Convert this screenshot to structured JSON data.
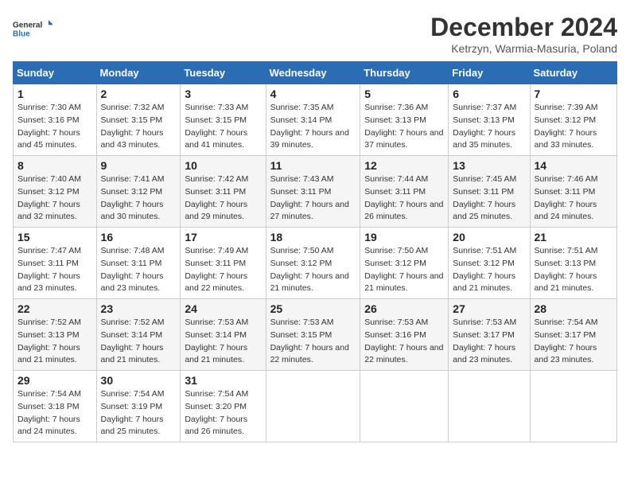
{
  "logo": {
    "general": "General",
    "blue": "Blue"
  },
  "title": "December 2024",
  "subtitle": "Ketrzyn, Warmia-Masuria, Poland",
  "header_days": [
    "Sunday",
    "Monday",
    "Tuesday",
    "Wednesday",
    "Thursday",
    "Friday",
    "Saturday"
  ],
  "weeks": [
    [
      {
        "day": "1",
        "sunrise": "Sunrise: 7:30 AM",
        "sunset": "Sunset: 3:16 PM",
        "daylight": "Daylight: 7 hours and 45 minutes."
      },
      {
        "day": "2",
        "sunrise": "Sunrise: 7:32 AM",
        "sunset": "Sunset: 3:15 PM",
        "daylight": "Daylight: 7 hours and 43 minutes."
      },
      {
        "day": "3",
        "sunrise": "Sunrise: 7:33 AM",
        "sunset": "Sunset: 3:15 PM",
        "daylight": "Daylight: 7 hours and 41 minutes."
      },
      {
        "day": "4",
        "sunrise": "Sunrise: 7:35 AM",
        "sunset": "Sunset: 3:14 PM",
        "daylight": "Daylight: 7 hours and 39 minutes."
      },
      {
        "day": "5",
        "sunrise": "Sunrise: 7:36 AM",
        "sunset": "Sunset: 3:13 PM",
        "daylight": "Daylight: 7 hours and 37 minutes."
      },
      {
        "day": "6",
        "sunrise": "Sunrise: 7:37 AM",
        "sunset": "Sunset: 3:13 PM",
        "daylight": "Daylight: 7 hours and 35 minutes."
      },
      {
        "day": "7",
        "sunrise": "Sunrise: 7:39 AM",
        "sunset": "Sunset: 3:12 PM",
        "daylight": "Daylight: 7 hours and 33 minutes."
      }
    ],
    [
      {
        "day": "8",
        "sunrise": "Sunrise: 7:40 AM",
        "sunset": "Sunset: 3:12 PM",
        "daylight": "Daylight: 7 hours and 32 minutes."
      },
      {
        "day": "9",
        "sunrise": "Sunrise: 7:41 AM",
        "sunset": "Sunset: 3:12 PM",
        "daylight": "Daylight: 7 hours and 30 minutes."
      },
      {
        "day": "10",
        "sunrise": "Sunrise: 7:42 AM",
        "sunset": "Sunset: 3:11 PM",
        "daylight": "Daylight: 7 hours and 29 minutes."
      },
      {
        "day": "11",
        "sunrise": "Sunrise: 7:43 AM",
        "sunset": "Sunset: 3:11 PM",
        "daylight": "Daylight: 7 hours and 27 minutes."
      },
      {
        "day": "12",
        "sunrise": "Sunrise: 7:44 AM",
        "sunset": "Sunset: 3:11 PM",
        "daylight": "Daylight: 7 hours and 26 minutes."
      },
      {
        "day": "13",
        "sunrise": "Sunrise: 7:45 AM",
        "sunset": "Sunset: 3:11 PM",
        "daylight": "Daylight: 7 hours and 25 minutes."
      },
      {
        "day": "14",
        "sunrise": "Sunrise: 7:46 AM",
        "sunset": "Sunset: 3:11 PM",
        "daylight": "Daylight: 7 hours and 24 minutes."
      }
    ],
    [
      {
        "day": "15",
        "sunrise": "Sunrise: 7:47 AM",
        "sunset": "Sunset: 3:11 PM",
        "daylight": "Daylight: 7 hours and 23 minutes."
      },
      {
        "day": "16",
        "sunrise": "Sunrise: 7:48 AM",
        "sunset": "Sunset: 3:11 PM",
        "daylight": "Daylight: 7 hours and 23 minutes."
      },
      {
        "day": "17",
        "sunrise": "Sunrise: 7:49 AM",
        "sunset": "Sunset: 3:11 PM",
        "daylight": "Daylight: 7 hours and 22 minutes."
      },
      {
        "day": "18",
        "sunrise": "Sunrise: 7:50 AM",
        "sunset": "Sunset: 3:12 PM",
        "daylight": "Daylight: 7 hours and 21 minutes."
      },
      {
        "day": "19",
        "sunrise": "Sunrise: 7:50 AM",
        "sunset": "Sunset: 3:12 PM",
        "daylight": "Daylight: 7 hours and 21 minutes."
      },
      {
        "day": "20",
        "sunrise": "Sunrise: 7:51 AM",
        "sunset": "Sunset: 3:12 PM",
        "daylight": "Daylight: 7 hours and 21 minutes."
      },
      {
        "day": "21",
        "sunrise": "Sunrise: 7:51 AM",
        "sunset": "Sunset: 3:13 PM",
        "daylight": "Daylight: 7 hours and 21 minutes."
      }
    ],
    [
      {
        "day": "22",
        "sunrise": "Sunrise: 7:52 AM",
        "sunset": "Sunset: 3:13 PM",
        "daylight": "Daylight: 7 hours and 21 minutes."
      },
      {
        "day": "23",
        "sunrise": "Sunrise: 7:52 AM",
        "sunset": "Sunset: 3:14 PM",
        "daylight": "Daylight: 7 hours and 21 minutes."
      },
      {
        "day": "24",
        "sunrise": "Sunrise: 7:53 AM",
        "sunset": "Sunset: 3:14 PM",
        "daylight": "Daylight: 7 hours and 21 minutes."
      },
      {
        "day": "25",
        "sunrise": "Sunrise: 7:53 AM",
        "sunset": "Sunset: 3:15 PM",
        "daylight": "Daylight: 7 hours and 22 minutes."
      },
      {
        "day": "26",
        "sunrise": "Sunrise: 7:53 AM",
        "sunset": "Sunset: 3:16 PM",
        "daylight": "Daylight: 7 hours and 22 minutes."
      },
      {
        "day": "27",
        "sunrise": "Sunrise: 7:53 AM",
        "sunset": "Sunset: 3:17 PM",
        "daylight": "Daylight: 7 hours and 23 minutes."
      },
      {
        "day": "28",
        "sunrise": "Sunrise: 7:54 AM",
        "sunset": "Sunset: 3:17 PM",
        "daylight": "Daylight: 7 hours and 23 minutes."
      }
    ],
    [
      {
        "day": "29",
        "sunrise": "Sunrise: 7:54 AM",
        "sunset": "Sunset: 3:18 PM",
        "daylight": "Daylight: 7 hours and 24 minutes."
      },
      {
        "day": "30",
        "sunrise": "Sunrise: 7:54 AM",
        "sunset": "Sunset: 3:19 PM",
        "daylight": "Daylight: 7 hours and 25 minutes."
      },
      {
        "day": "31",
        "sunrise": "Sunrise: 7:54 AM",
        "sunset": "Sunset: 3:20 PM",
        "daylight": "Daylight: 7 hours and 26 minutes."
      },
      null,
      null,
      null,
      null
    ]
  ]
}
